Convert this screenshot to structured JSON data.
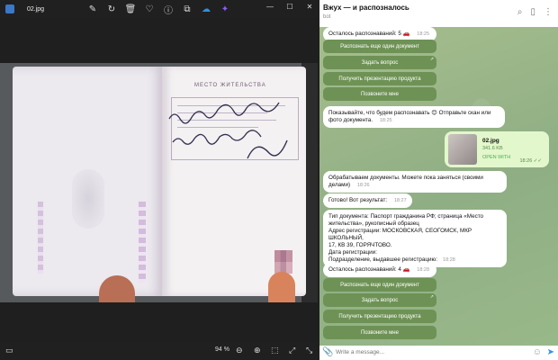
{
  "viewer": {
    "file_name": "02.jpg",
    "zoom": "94 %",
    "photo": {
      "section_title": "МЕСТО ЖИТЕЛЬСТВА",
      "handwriting": [
        "мкр Школьный",
        "18 января 2017"
      ]
    },
    "tool_icons": [
      "edit-icon",
      "rotate-icon",
      "delete-icon",
      "favorite-icon",
      "info-icon",
      "crop-icon",
      "cloud-icon",
      "effects-icon"
    ]
  },
  "telegram": {
    "chat_title": "Вжух — и распозналось",
    "chat_subtitle": "bot",
    "messages": {
      "remaining_top": "Осталось распознаваний: 5",
      "remaining_top_time": "18:25",
      "prompt": "Показывайте, что будем распознавать 😊 Отправьте скан или фото документа.",
      "prompt_time": "18:25",
      "processing": "Обрабатываем документы. Можете пока заняться (своими делами)",
      "processing_time": "18:26",
      "ready": "Готово! Вот результат:",
      "ready_time": "18:27",
      "result_lines": [
        "Тип документа: Паспорт гражданина РФ; страница «Место",
        "жительства», рукописный образец",
        "Адрес регистрации: МОСКОВСКАЯ, СЕОГОМСК, МКР ШКОЛЬНЫЙ,",
        "17, КВ 39, ГОРЯЧТОВО.",
        "Дата регистрации:",
        "Подразделение, выдавшее регистрацию:"
      ],
      "result_time": "18:28",
      "remaining_bottom": "Осталось распознаваний: 4",
      "remaining_bottom_time": "18:28"
    },
    "buttons": [
      "Распознать еще один документ",
      "Задать вопрос",
      "Получить презентацию продукта",
      "Позвоните мне"
    ],
    "file": {
      "name": "02.jpg",
      "size": "341.6 KB",
      "action": "OPEN WITH",
      "time": "18:26"
    },
    "input_placeholder": "Write a message..."
  },
  "colors": {
    "keyboard_button": "#6e9255",
    "outgoing_bubble": "#e2f7cc",
    "chat_background": "#9cb58a"
  }
}
